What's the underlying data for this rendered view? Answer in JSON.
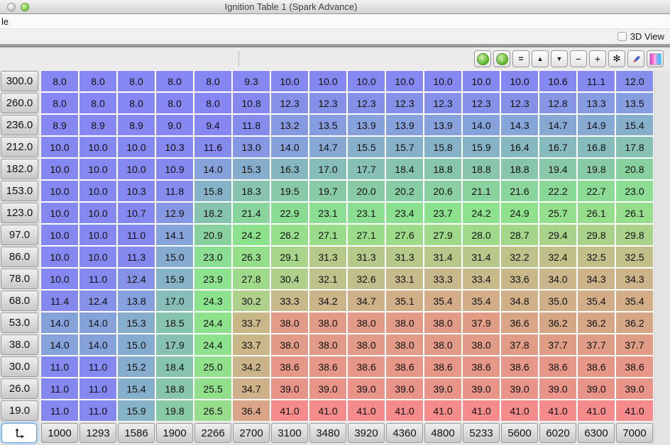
{
  "window": {
    "title": "Ignition Table 1 (Spark Advance)"
  },
  "menu": {
    "truncated_item": "le"
  },
  "view_bar": {
    "toggle_label": "3D View",
    "checked": false
  },
  "toolbar": {
    "buttons": [
      {
        "id": "arrow-up-circle",
        "glyph": "↑"
      },
      {
        "id": "arrow-down-circle",
        "glyph": "↓"
      },
      {
        "id": "set-equal",
        "glyph": "="
      },
      {
        "id": "increment",
        "glyph": "▲"
      },
      {
        "id": "decrement",
        "glyph": "▼"
      },
      {
        "id": "subtract",
        "glyph": "−"
      },
      {
        "id": "add",
        "glyph": "+"
      },
      {
        "id": "multiply",
        "glyph": "✻"
      },
      {
        "id": "edit-pencil",
        "icon": "pencil-icon"
      },
      {
        "id": "color-gradient",
        "icon": "gradient-icon"
      }
    ]
  },
  "table": {
    "x_axis": [
      1000,
      1293,
      1586,
      1900,
      2266,
      2700,
      3100,
      3480,
      3920,
      4360,
      4800,
      5233,
      5600,
      6020,
      6300,
      7000
    ],
    "y_axis": [
      300.0,
      260.0,
      236.0,
      212.0,
      182.0,
      153.0,
      123.0,
      97.0,
      86.0,
      78.0,
      68.0,
      53.0,
      38.0,
      30.0,
      26.0,
      19.0
    ],
    "values": [
      [
        8.0,
        8.0,
        8.0,
        8.0,
        8.0,
        9.3,
        10.0,
        10.0,
        10.0,
        10.0,
        10.0,
        10.0,
        10.0,
        10.6,
        11.1,
        12.0
      ],
      [
        8.0,
        8.0,
        8.0,
        8.0,
        8.0,
        10.8,
        12.3,
        12.3,
        12.3,
        12.3,
        12.3,
        12.3,
        12.3,
        12.8,
        13.3,
        13.5
      ],
      [
        8.9,
        8.9,
        8.9,
        9.0,
        9.4,
        11.8,
        13.2,
        13.5,
        13.9,
        13.9,
        13.9,
        14.0,
        14.3,
        14.7,
        14.9,
        15.4
      ],
      [
        10.0,
        10.0,
        10.0,
        10.3,
        11.6,
        13.0,
        14.0,
        14.7,
        15.5,
        15.7,
        15.8,
        15.9,
        16.4,
        16.7,
        16.8,
        17.8
      ],
      [
        10.0,
        10.0,
        10.0,
        10.9,
        14.0,
        15.3,
        16.3,
        17.0,
        17.7,
        18.4,
        18.8,
        18.8,
        18.8,
        19.4,
        19.8,
        20.8
      ],
      [
        10.0,
        10.0,
        10.3,
        11.8,
        15.8,
        18.3,
        19.5,
        19.7,
        20.0,
        20.2,
        20.6,
        21.1,
        21.6,
        22.2,
        22.7,
        23.0
      ],
      [
        10.0,
        10.0,
        10.7,
        12.9,
        18.2,
        21.4,
        22.9,
        23.1,
        23.1,
        23.4,
        23.7,
        24.2,
        24.9,
        25.7,
        26.1,
        26.1
      ],
      [
        10.0,
        10.0,
        11.0,
        14.1,
        20.9,
        24.2,
        26.2,
        27.1,
        27.1,
        27.6,
        27.9,
        28.0,
        28.7,
        29.4,
        29.8,
        29.8
      ],
      [
        10.0,
        10.0,
        11.3,
        15.0,
        23.0,
        26.3,
        29.1,
        31.3,
        31.3,
        31.3,
        31.4,
        31.4,
        32.2,
        32.4,
        32.5,
        32.5
      ],
      [
        10.0,
        11.0,
        12.4,
        15.9,
        23.9,
        27.8,
        30.4,
        32.1,
        32.6,
        33.1,
        33.3,
        33.4,
        33.6,
        34.0,
        34.3,
        34.3
      ],
      [
        11.4,
        12.4,
        13.8,
        17.0,
        24.3,
        30.2,
        33.3,
        34.2,
        34.7,
        35.1,
        35.4,
        35.4,
        34.8,
        35.0,
        35.4,
        35.4
      ],
      [
        14.0,
        14.0,
        15.3,
        18.5,
        24.4,
        33.7,
        38.0,
        38.0,
        38.0,
        38.0,
        38.0,
        37.9,
        36.6,
        36.2,
        36.2,
        36.2
      ],
      [
        14.0,
        14.0,
        15.0,
        17.9,
        24.4,
        33.7,
        38.0,
        38.0,
        38.0,
        38.0,
        38.0,
        38.0,
        37.8,
        37.7,
        37.7,
        37.7
      ],
      [
        11.0,
        11.0,
        15.2,
        18.4,
        25.0,
        34.2,
        38.6,
        38.6,
        38.6,
        38.6,
        38.6,
        38.6,
        38.6,
        38.6,
        38.6,
        38.6
      ],
      [
        11.0,
        11.0,
        15.4,
        18.8,
        25.5,
        34.7,
        39.0,
        39.0,
        39.0,
        39.0,
        39.0,
        39.0,
        39.0,
        39.0,
        39.0,
        39.0
      ],
      [
        11.0,
        11.0,
        15.9,
        19.8,
        26.5,
        36.4,
        41.0,
        41.0,
        41.0,
        41.0,
        41.0,
        41.0,
        41.0,
        41.0,
        41.0,
        41.0
      ]
    ],
    "color_scale": {
      "anchors": [
        [
          8.0,
          "#8686F5"
        ],
        [
          11.5,
          "#8589EE"
        ],
        [
          14.0,
          "#86A2DB"
        ],
        [
          17.0,
          "#86BDB9"
        ],
        [
          20.0,
          "#88CBA4"
        ],
        [
          24.0,
          "#8CE38D"
        ],
        [
          27.5,
          "#9CDB8A"
        ],
        [
          30.5,
          "#B0CF8A"
        ],
        [
          33.0,
          "#C6BB8B"
        ],
        [
          35.5,
          "#D2AC88"
        ],
        [
          38.0,
          "#E29B86"
        ],
        [
          39.5,
          "#EC9189"
        ],
        [
          41.0,
          "#F68B8B"
        ]
      ]
    }
  }
}
